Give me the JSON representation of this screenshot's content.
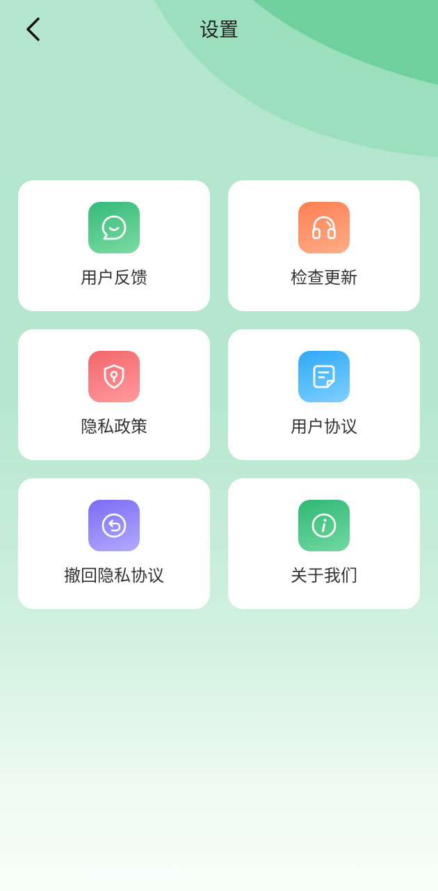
{
  "header": {
    "title": "设置"
  },
  "icons": {
    "back": "chevron-left-icon"
  },
  "colors": {
    "text_primary": "#222222",
    "card_background": "#ffffff",
    "feedback_tile": [
      "#35b97a",
      "#7cdca2"
    ],
    "update_tile": [
      "#ff7e54",
      "#ffad86"
    ],
    "privacy_tile": [
      "#f2666c",
      "#ff9a9c"
    ],
    "agreement_tile": [
      "#2ea8f5",
      "#7fd0ff"
    ],
    "revoke_tile": [
      "#7a6cf5",
      "#b4a9ff"
    ],
    "about_tile": [
      "#2fb874",
      "#72d9a0"
    ]
  },
  "menu": {
    "items": [
      {
        "label": "用户反馈",
        "icon": "chat-bubble-icon"
      },
      {
        "label": "检查更新",
        "icon": "headset-icon"
      },
      {
        "label": "隐私政策",
        "icon": "shield-keyhole-icon"
      },
      {
        "label": "用户协议",
        "icon": "document-icon"
      },
      {
        "label": "撤回隐私协议",
        "icon": "undo-circle-icon"
      },
      {
        "label": "关于我们",
        "icon": "info-circle-icon"
      }
    ]
  }
}
